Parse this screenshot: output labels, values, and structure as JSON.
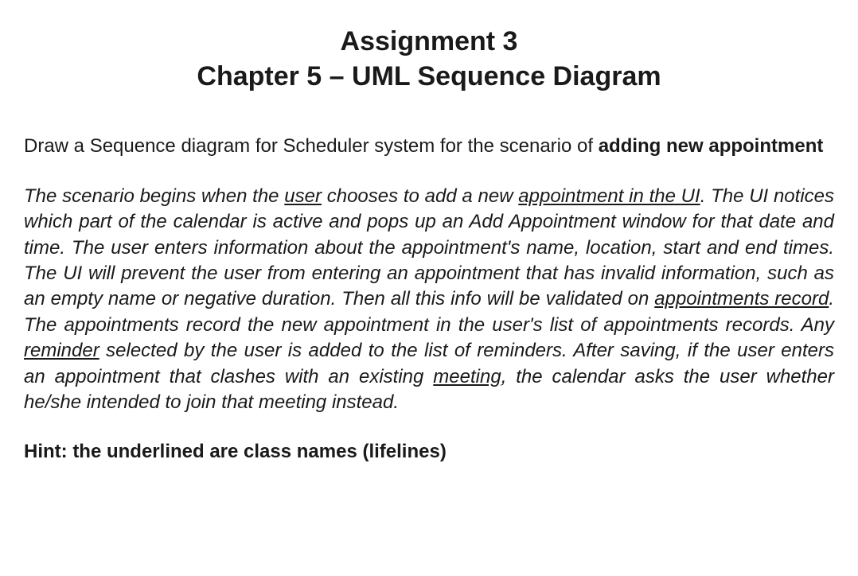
{
  "title": {
    "line1": "Assignment 3",
    "line2": "Chapter 5 – UML Sequence Diagram"
  },
  "intro": {
    "prefix": "Draw a Sequence diagram for Scheduler system for the scenario of ",
    "bold": "adding new appointment"
  },
  "scenario": {
    "s1": "The scenario begins when the ",
    "u1": "user",
    "s2": " chooses to add a new ",
    "u2": "appointment in the UI",
    "s3": ". The UI notices which part of the calendar is active and pops up an Add Appointment window for that date and time. The user enters information about the appointment's name, location, start and end times. The UI will prevent the user from entering an appointment that has invalid information, such as an empty name or negative duration. Then all this info will be validated on ",
    "u3": "appointments record",
    "s4": ". The appointments record the new appointment in the user's list of appointments records. Any ",
    "u4": "reminder",
    "s5": " selected by the user is added to the list of reminders. After saving, if the user enters an appointment that clashes with an existing ",
    "u5": "meeting",
    "s6": ", the calendar asks the user whether he/she intended to join that meeting instead."
  },
  "hint": "Hint: the underlined are class names (lifelines)"
}
